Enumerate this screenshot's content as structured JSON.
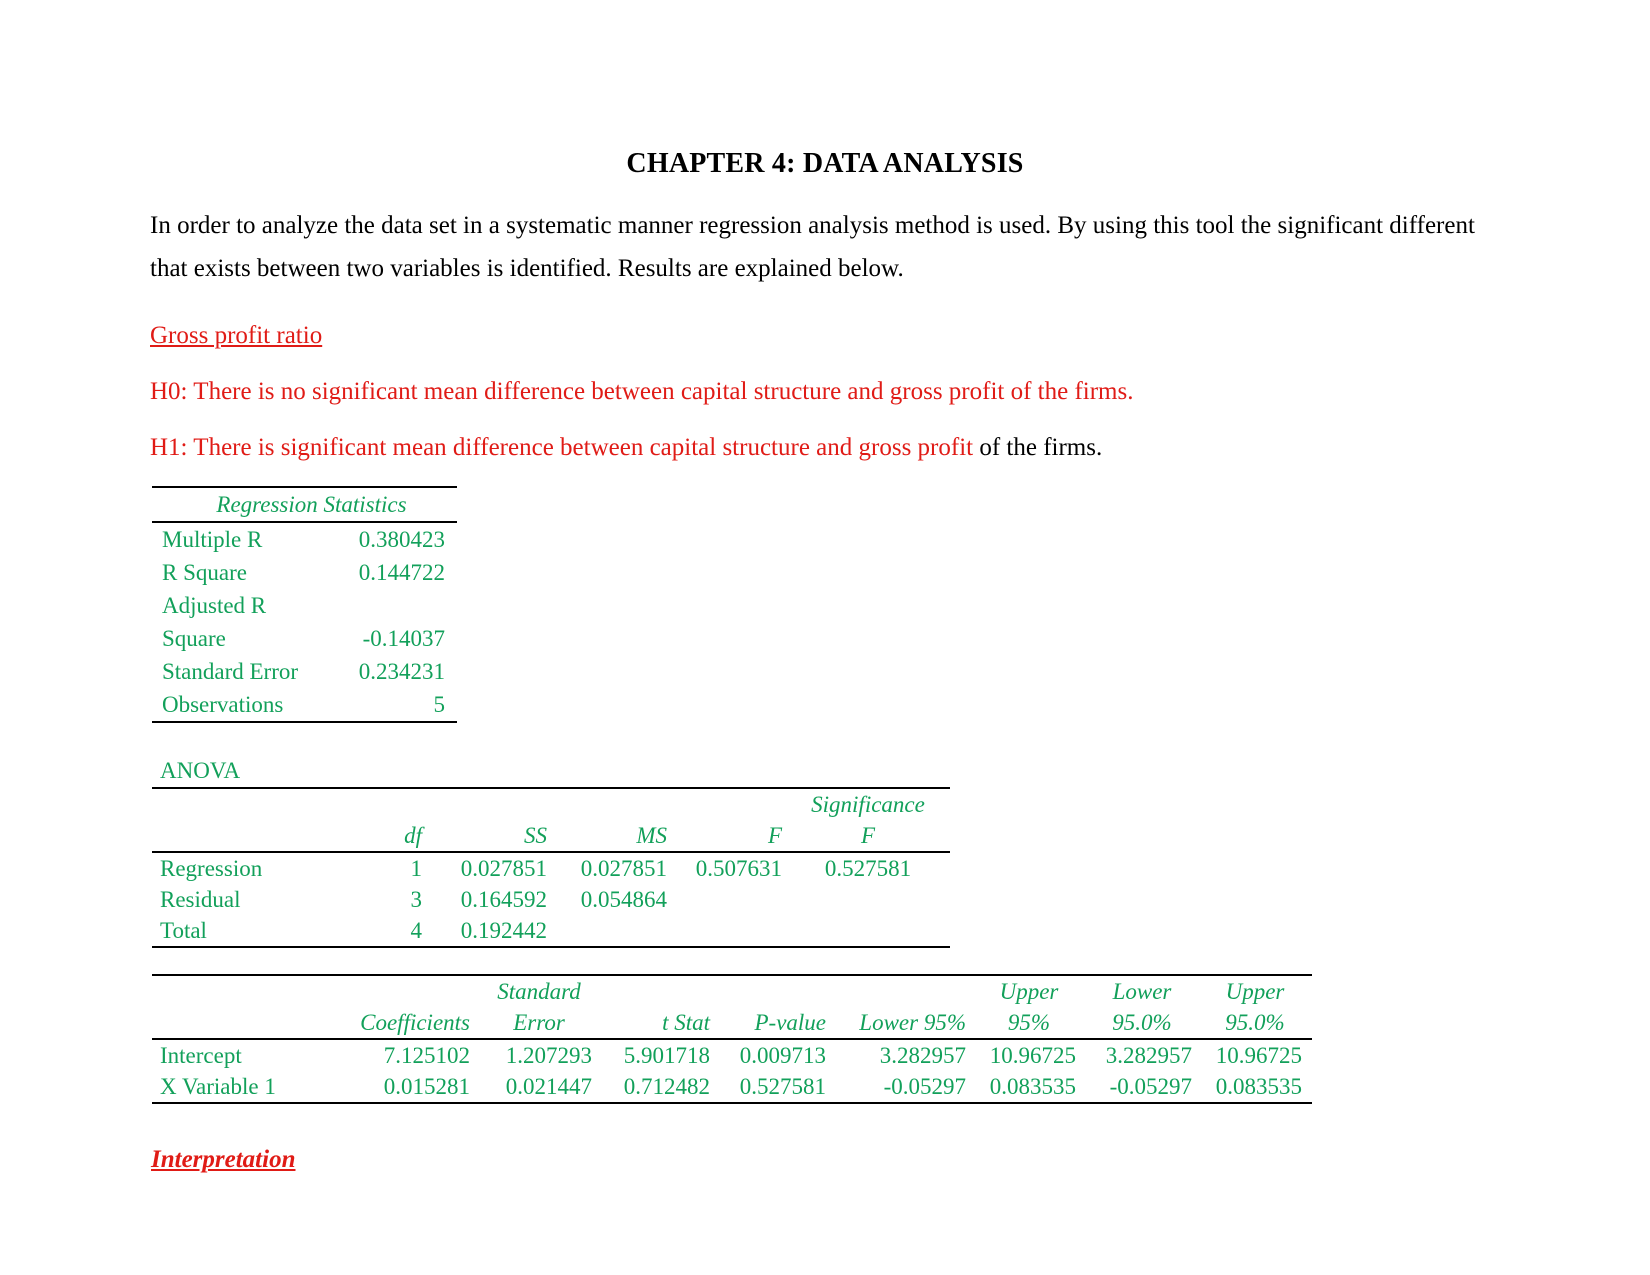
{
  "document": {
    "title": "CHAPTER 4: DATA ANALYSIS",
    "intro_paragraph": "In order to analyze the data set in a systematic manner regression analysis method is used. By using this tool the significant different that exists between two variables is identified. Results are explained below.",
    "section_heading": "Gross profit ratio",
    "hypotheses": {
      "h0": "H0: There is no significant mean difference between capital structure and gross profit of the firms.",
      "h1_red": "H1: There is significant mean difference between capital structure and gross profit",
      "h1_black": " of the firms."
    },
    "interpretation_heading": "Interpretation"
  },
  "colors": {
    "red": "#e01b16",
    "green": "#12a05a",
    "black": "#000000"
  },
  "regression_statistics": {
    "title": "Regression Statistics",
    "rows": [
      {
        "label": "Multiple R",
        "value": "0.380423"
      },
      {
        "label": "R Square",
        "value": "0.144722"
      },
      {
        "label": "Adjusted R",
        "value": ""
      },
      {
        "label": "Square",
        "value": "-0.14037"
      },
      {
        "label": "Standard Error",
        "value": "0.234231"
      },
      {
        "label": "Observations",
        "value": "5"
      }
    ]
  },
  "anova": {
    "title": "ANOVA",
    "headers": {
      "blank": "",
      "df": "df",
      "ss": "SS",
      "ms": "MS",
      "f": "F",
      "sig_f_line1": "Significance",
      "sig_f_line2": "F"
    },
    "rows": [
      {
        "name": "Regression",
        "df": "1",
        "ss": "0.027851",
        "ms": "0.027851",
        "f": "0.507631",
        "sig_f": "0.527581"
      },
      {
        "name": "Residual",
        "df": "3",
        "ss": "0.164592",
        "ms": "0.054864",
        "f": "",
        "sig_f": ""
      },
      {
        "name": "Total",
        "df": "4",
        "ss": "0.192442",
        "ms": "",
        "f": "",
        "sig_f": ""
      }
    ]
  },
  "coefficients": {
    "headers": {
      "blank": "",
      "coefficients": "Coefficients",
      "standard_error_line1": "Standard",
      "standard_error_line2": "Error",
      "t_stat": "t Stat",
      "p_value": "P-value",
      "lower_95": "Lower 95%",
      "upper_95_line1": "Upper",
      "upper_95_line2": "95%",
      "lower_950_line1": "Lower",
      "lower_950_line2": "95.0%",
      "upper_950_line1": "Upper",
      "upper_950_line2": "95.0%"
    },
    "rows": [
      {
        "name": "Intercept",
        "coefficient": "7.125102",
        "standard_error": "1.207293",
        "t_stat": "5.901718",
        "p_value": "0.009713",
        "lower_95": "3.282957",
        "upper_95": "10.96725",
        "lower_950": "3.282957",
        "upper_950": "10.96725"
      },
      {
        "name": "X Variable 1",
        "coefficient": "0.015281",
        "standard_error": "0.021447",
        "t_stat": "0.712482",
        "p_value": "0.527581",
        "lower_95": "-0.05297",
        "upper_95": "0.083535",
        "lower_950": "-0.05297",
        "upper_950": "0.083535"
      }
    ]
  }
}
